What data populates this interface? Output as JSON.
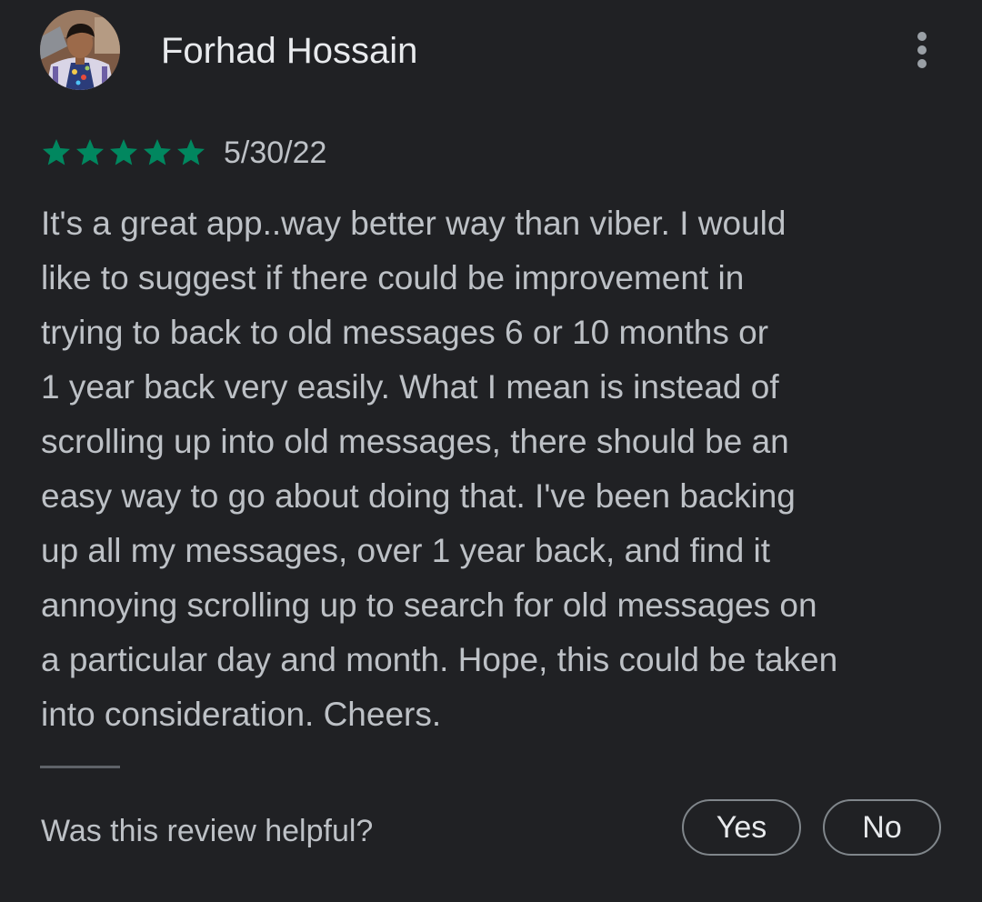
{
  "review": {
    "reviewer_name": "Forhad Hossain",
    "rating": 5,
    "rating_max": 5,
    "date": "5/30/22",
    "text_lines": [
      "It's a great app..way better way than viber. I would",
      "like to suggest if there could be improvement in",
      "trying to back to old messages 6 or 10 months or",
      "1 year back very easily. What I mean is instead of",
      "scrolling up into old messages, there should be an",
      "easy way to go about doing that. I've been backing",
      "up all my messages, over 1 year back, and find it",
      "annoying scrolling up to search for old messages on",
      "a particular day and month. Hope, this could be taken",
      "into consideration. Cheers."
    ]
  },
  "helpful": {
    "prompt": "Was this review helpful?",
    "yes_label": "Yes",
    "no_label": "No"
  },
  "icons": {
    "more": "more-vert-icon",
    "star": "star-icon"
  },
  "colors": {
    "background": "#202124",
    "star": "#01875f",
    "primary_text": "#e8eaed",
    "secondary_text": "#bdc1c6",
    "outline": "#80868b"
  }
}
